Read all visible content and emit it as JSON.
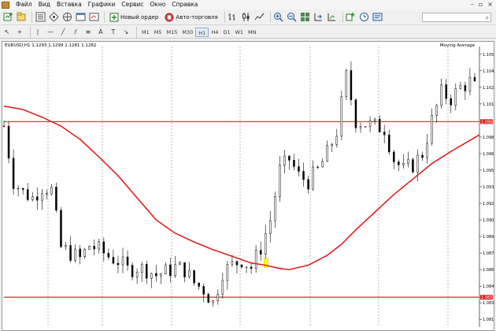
{
  "menu": {
    "items": [
      "Файл",
      "Вид",
      "Вставка",
      "Графики",
      "Сервис",
      "Окно",
      "Справка"
    ]
  },
  "toolbar": {
    "new_order_label": "Новый ордер",
    "auto_trading_label": "Авто-торговля"
  },
  "timeframes": [
    "M1",
    "M5",
    "M15",
    "M30",
    "H1",
    "H4",
    "D1",
    "W1",
    "MN"
  ],
  "active_timeframe": "H1",
  "chart": {
    "header": "EURUSD,H1  1.1293 1.1299 1.1281 1.1282",
    "indicator_label": "Moving Average",
    "price_labels": [
      "1.1055",
      "1.1040",
      "1.1025",
      "1.1010",
      "1.0994",
      "1.0980",
      "1.0965",
      "1.0950",
      "1.0935",
      "1.0920",
      "1.0905",
      "1.0890",
      "1.0875",
      "1.0860",
      "1.0845",
      "1.0835",
      "1.0830",
      "1.0815"
    ],
    "hline_labels": [
      "1.0994",
      "1.0835"
    ],
    "line_color": "#e02020",
    "colors": {
      "ma": "#e02020",
      "hline": "#e02020",
      "grid": "#9a9a9a",
      "candle": "#000000",
      "marker": "#ffff00"
    }
  },
  "chart_data": {
    "type": "line",
    "symbol": "EURUSD",
    "timeframe": "H1",
    "ylim": [
      1.0808,
      1.1062
    ],
    "horizontal_levels": [
      1.0994,
      1.0835
    ],
    "series": [
      {
        "name": "Moving Average",
        "x": [
          0,
          8,
          16,
          24,
          32,
          40,
          48,
          56,
          64,
          72,
          80,
          88,
          96,
          104,
          110,
          116,
          120,
          128,
          136,
          142,
          148,
          156,
          164,
          172,
          180,
          188,
          200
        ],
        "values": [
          1.1008,
          1.1005,
          1.0998,
          1.099,
          1.0978,
          1.0962,
          1.0945,
          1.0925,
          1.0905,
          1.0893,
          1.0885,
          1.0878,
          1.0872,
          1.0866,
          1.0864,
          1.0861,
          1.086,
          1.0864,
          1.0873,
          1.0883,
          1.0896,
          1.0912,
          1.0928,
          1.0942,
          1.0956,
          1.0967,
          1.0982
        ]
      },
      {
        "name": "EURUSD",
        "x": [
          0,
          4,
          8,
          12,
          16,
          20,
          24,
          28,
          32,
          36,
          40,
          44,
          48,
          52,
          56,
          60,
          64,
          68,
          72,
          76,
          80,
          84,
          88,
          92,
          96,
          100,
          104,
          108,
          112,
          116,
          120,
          124,
          128,
          132,
          136,
          140,
          144,
          148,
          152,
          156,
          160,
          164,
          168,
          172,
          176,
          180,
          184,
          188,
          192,
          196,
          200
        ],
        "values": [
          1.099,
          1.094,
          1.093,
          1.0925,
          1.0935,
          1.0932,
          1.088,
          1.0875,
          1.087,
          1.0882,
          1.0878,
          1.0872,
          1.0868,
          1.086,
          1.0862,
          1.086,
          1.0855,
          1.0858,
          1.0862,
          1.086,
          1.0848,
          1.0842,
          1.083,
          1.0858,
          1.0864,
          1.0869,
          1.0862,
          1.088,
          1.0905,
          1.095,
          1.096,
          1.0945,
          1.094,
          1.095,
          1.0965,
          1.0985,
          1.1035,
          1.0995,
          1.0992,
          1.099,
          1.0988,
          1.096,
          1.095,
          1.0955,
          1.0965,
          1.0995,
          1.102,
          1.1015,
          1.1025,
          1.103,
          1.102
        ]
      }
    ]
  }
}
